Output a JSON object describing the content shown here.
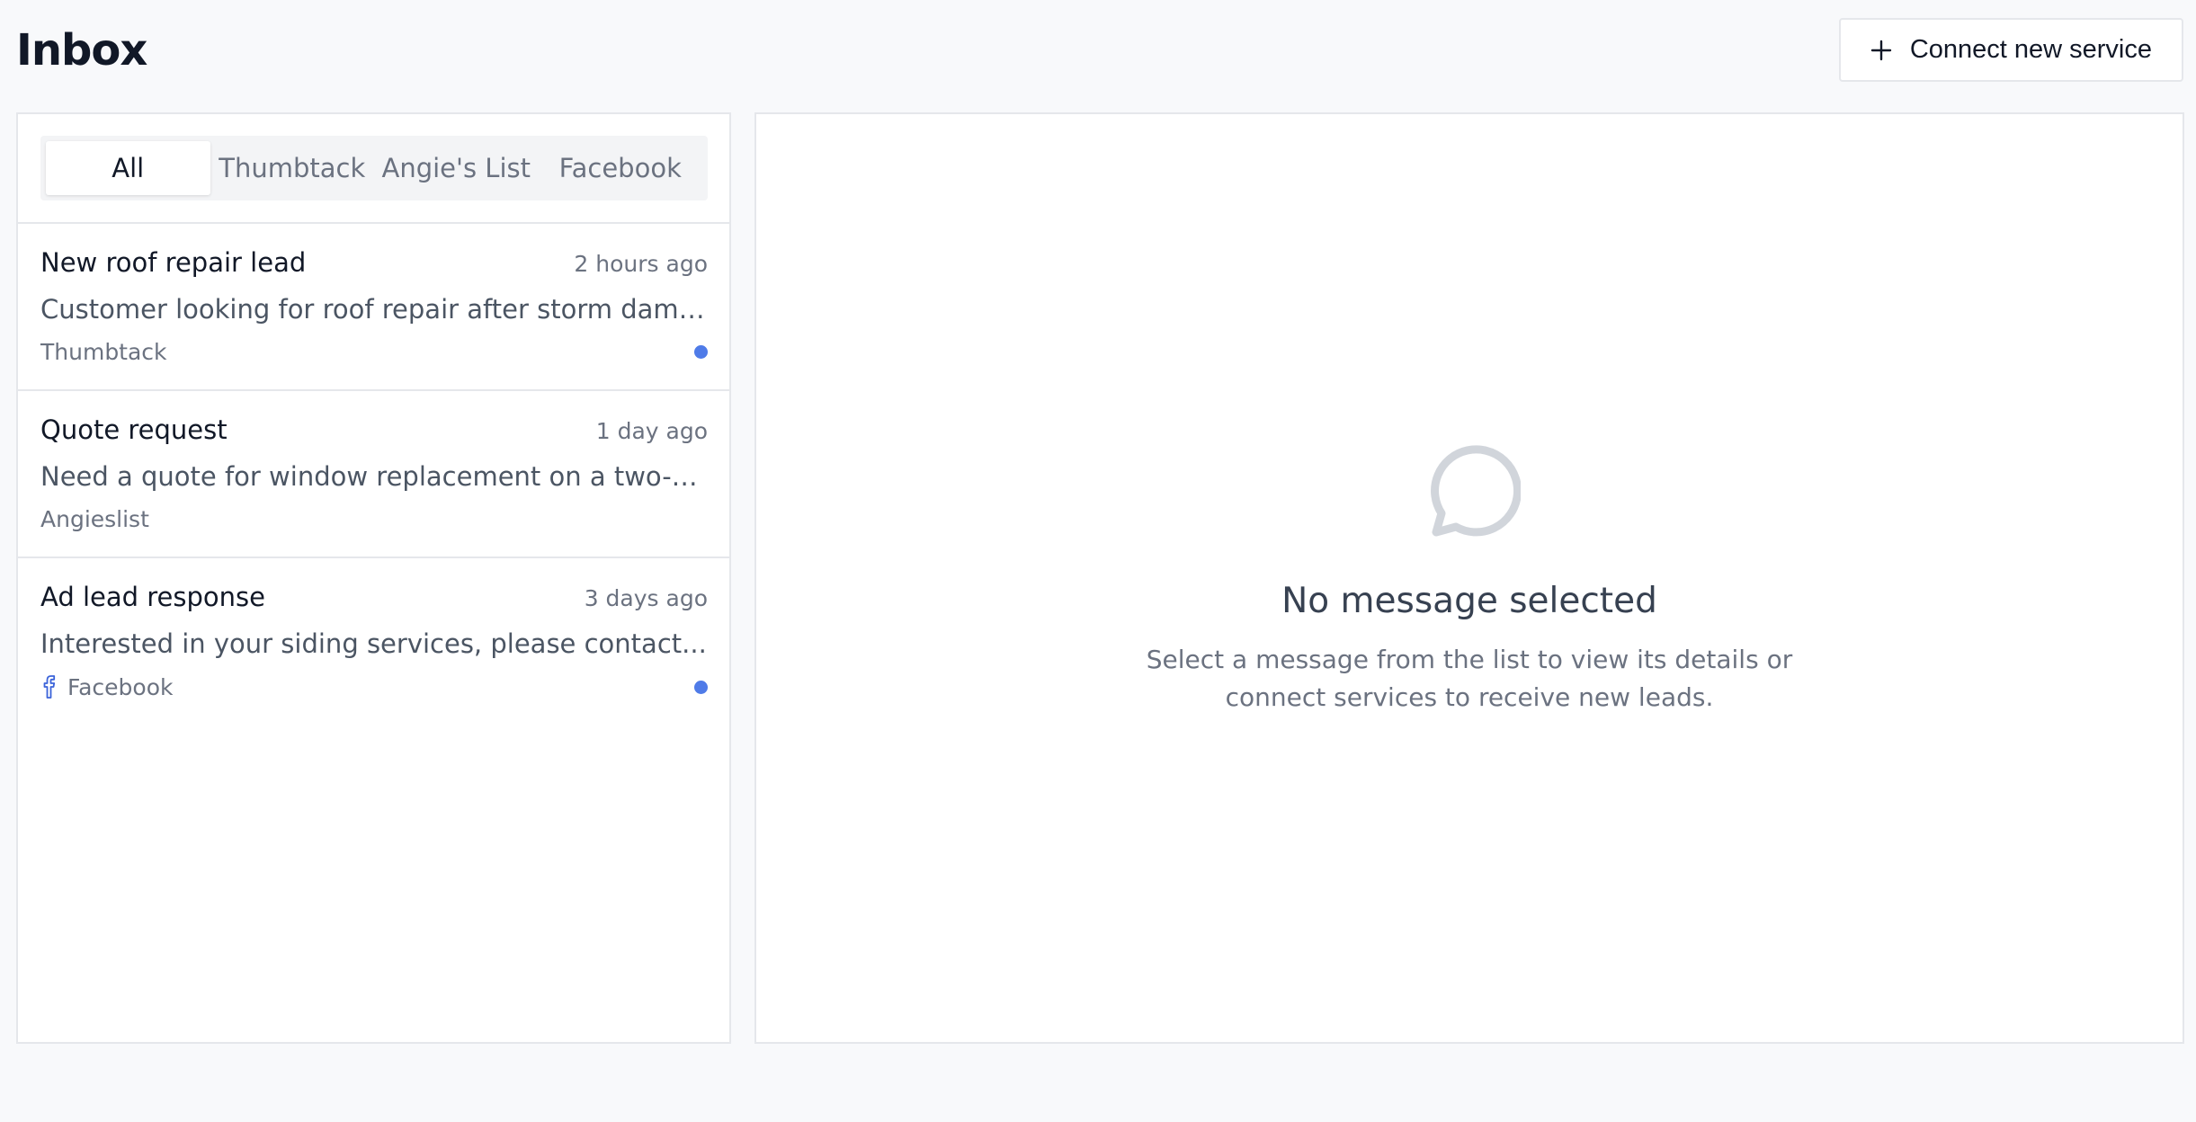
{
  "header": {
    "title": "Inbox",
    "connect_button": "Connect new service"
  },
  "tabs": [
    {
      "label": "All",
      "active": true
    },
    {
      "label": "Thumbtack",
      "active": false
    },
    {
      "label": "Angie's List",
      "active": false
    },
    {
      "label": "Facebook",
      "active": false
    }
  ],
  "messages": [
    {
      "title": "New roof repair lead",
      "time": "2 hours ago",
      "preview": "Customer looking for roof repair after storm damage...",
      "source": "Thumbtack",
      "unread": true
    },
    {
      "title": "Quote request",
      "time": "1 day ago",
      "preview": "Need a quote for window replacement on a two-story h...",
      "source": "Angieslist",
      "unread": false
    },
    {
      "title": "Ad lead response",
      "time": "3 days ago",
      "preview": "Interested in your siding services, please contact...",
      "source": "Facebook",
      "source_icon": "facebook-icon",
      "unread": true
    }
  ],
  "empty_state": {
    "icon": "chat-bubble-icon",
    "title": "No message selected",
    "description": "Select a message from the list to view its details or connect services to receive new leads."
  },
  "colors": {
    "unread_dot": "#4f7be8",
    "facebook_icon": "#3b63d9",
    "page_bg": "#f8f9fb",
    "border": "#e5e7eb"
  }
}
